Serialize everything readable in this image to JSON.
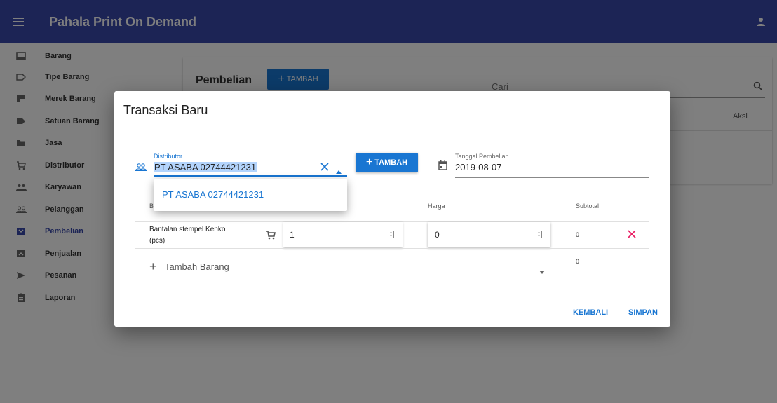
{
  "app": {
    "title": "Pahala Print On Demand"
  },
  "sidebar": {
    "items": [
      {
        "label": "Barang",
        "icon": "inbox-icon"
      },
      {
        "label": "Tipe Barang",
        "icon": "label-outline-icon"
      },
      {
        "label": "Merek Barang",
        "icon": "branding-icon"
      },
      {
        "label": "Satuan Barang",
        "icon": "label-icon"
      },
      {
        "label": "Jasa",
        "icon": "folder-icon"
      },
      {
        "label": "Distributor",
        "icon": "cart-icon"
      },
      {
        "label": "Karyawan",
        "icon": "people-icon"
      },
      {
        "label": "Pelanggan",
        "icon": "people-outline-icon"
      },
      {
        "label": "Pembelian",
        "icon": "download-box-icon"
      },
      {
        "label": "Penjualan",
        "icon": "upload-box-icon"
      },
      {
        "label": "Pesanan",
        "icon": "send-icon"
      },
      {
        "label": "Laporan",
        "icon": "clipboard-icon"
      }
    ],
    "active": "Pembelian",
    "active_color": "#3949ab"
  },
  "page": {
    "title": "Pembelian",
    "add_label": "TAMBAH",
    "search_placeholder": "Cari",
    "col_aksi": "Aksi"
  },
  "dialog": {
    "title": "Transaksi Baru",
    "distributor": {
      "label": "Distributor",
      "value": "PT ASABA 02744421231"
    },
    "add_distributor_label": "TAMBAH",
    "date": {
      "label": "Tanggal Pembelian",
      "value": "2019-08-07"
    },
    "columns": {
      "barang": "B",
      "harga": "Harga",
      "subtotal": "Subtotal"
    },
    "items": [
      {
        "name": "Bantalan stempel Kenko (pcs)",
        "qty": "1",
        "price": "0",
        "subtotal": "0"
      }
    ],
    "add_item_label": "Tambah Barang",
    "total": "0",
    "cancel_label": "KEMBALI",
    "save_label": "SIMPAN",
    "dropdown_options": [
      "PT ASABA 02744421231"
    ]
  },
  "colors": {
    "appbar": "#3949ab",
    "primary": "#1976d2",
    "danger": "#e91e63"
  }
}
